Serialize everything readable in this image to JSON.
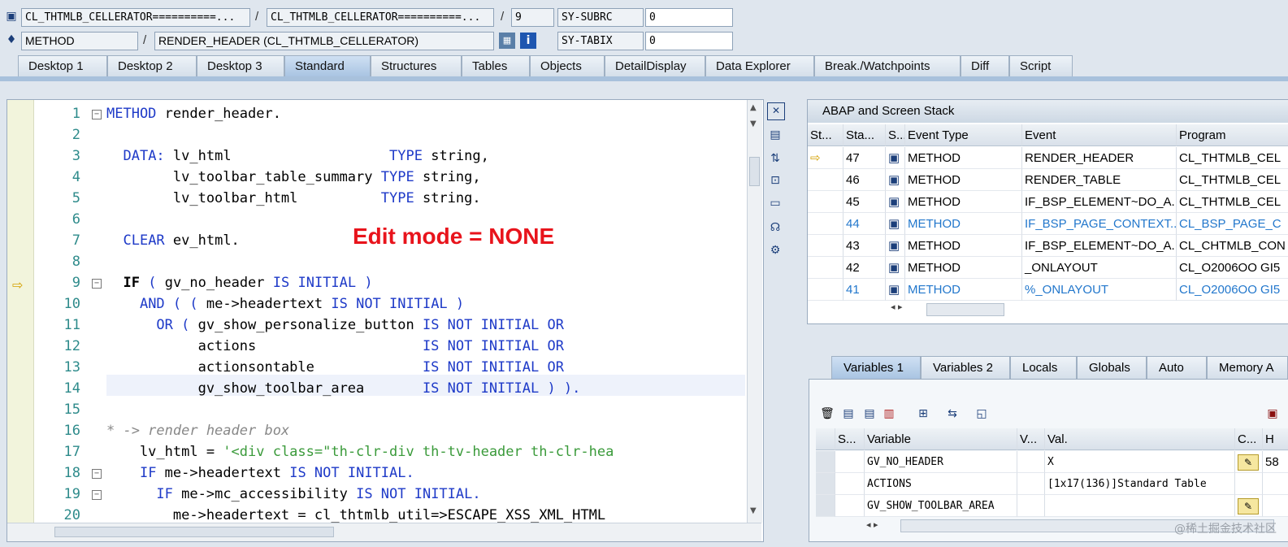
{
  "header": {
    "program1": "CL_THTMLB_CELLERATOR==========...",
    "program2": "CL_THTMLB_CELLERATOR==========...",
    "line_num": "9",
    "sy_subrc_label": "SY-SUBRC",
    "sy_subrc_value": "0",
    "type_label": "METHOD",
    "method_name": "RENDER_HEADER (CL_THTMLB_CELLERATOR)",
    "sy_tabix_label": "SY-TABIX",
    "sy_tabix_value": "0",
    "sep": "/"
  },
  "tabs": [
    "Desktop 1",
    "Desktop 2",
    "Desktop 3",
    "Standard",
    "Structures",
    "Tables",
    "Objects",
    "DetailDisplay",
    "Data Explorer",
    "Break./Watchpoints",
    "Diff",
    "Script"
  ],
  "editor": {
    "annotation": "Edit mode = NONE",
    "line_numbers": [
      "1",
      "2",
      "3",
      "4",
      "5",
      "6",
      "7",
      "8",
      "9",
      "10",
      "11",
      "12",
      "13",
      "14",
      "15",
      "16",
      "17",
      "18",
      "19",
      "20"
    ]
  },
  "stack": {
    "title": "ABAP and Screen Stack",
    "columns": [
      "St...",
      "Sta...",
      "S...",
      "Event Type",
      "Event",
      "Program"
    ],
    "rows": [
      {
        "level": "47",
        "type": "METHOD",
        "event": "RENDER_HEADER",
        "program": "CL_THTMLB_CEL"
      },
      {
        "level": "46",
        "type": "METHOD",
        "event": "RENDER_TABLE",
        "program": "CL_THTMLB_CEL"
      },
      {
        "level": "45",
        "type": "METHOD",
        "event": "IF_BSP_ELEMENT~DO_A...",
        "program": "CL_THTMLB_CEL"
      },
      {
        "level": "44",
        "type": "METHOD",
        "event": "IF_BSP_PAGE_CONTEXT...",
        "program": "CL_BSP_PAGE_C"
      },
      {
        "level": "43",
        "type": "METHOD",
        "event": "IF_BSP_ELEMENT~DO_A...",
        "program": "CL_CHTMLB_CON"
      },
      {
        "level": "42",
        "type": "METHOD",
        "event": "_ONLAYOUT",
        "program": "CL_O2006OO GI5"
      },
      {
        "level": "41",
        "type": "METHOD",
        "event": "%_ONLAYOUT",
        "program": "CL_O2006OO GI5"
      }
    ]
  },
  "var_tabs": [
    "Variables 1",
    "Variables 2",
    "Locals",
    "Globals",
    "Auto",
    "Memory A"
  ],
  "variables": {
    "columns": [
      "S...",
      "Variable",
      "V...",
      "Val.",
      "C...",
      "H"
    ],
    "rows": [
      {
        "name": "GV_NO_HEADER",
        "value": "X",
        "extra": "58"
      },
      {
        "name": "ACTIONS",
        "value": "[1x17(136)]Standard Table",
        "extra": ""
      },
      {
        "name": "GV_SHOW_TOOLBAR_AREA",
        "value": "",
        "extra": ""
      }
    ]
  },
  "watermark": "@稀土掘金技术社区",
  "colors": {
    "keyword": "#1e3ac8",
    "string": "#3a9a3a",
    "annotation": "#e8141c",
    "line_number": "#2e8b8b"
  }
}
